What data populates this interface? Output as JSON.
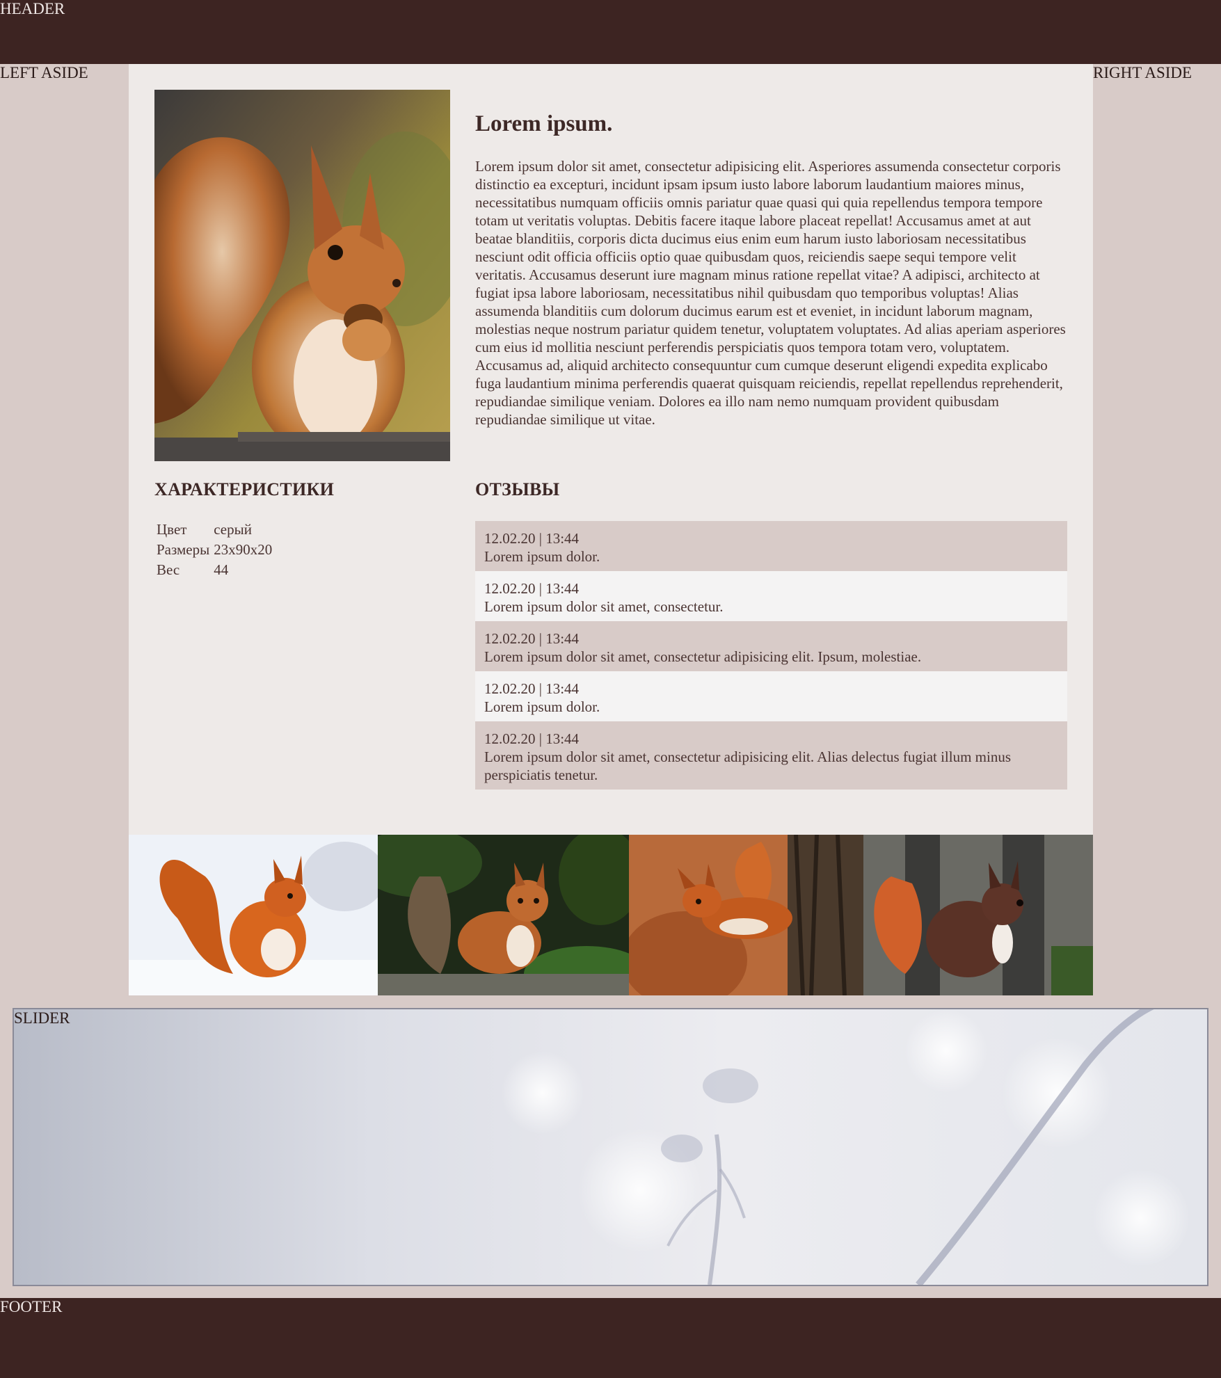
{
  "layout_labels": {
    "header": "HEADER",
    "left_aside": "LEFT ASIDE",
    "right_aside": "RIGHT ASIDE",
    "slider": "SLIDER",
    "footer": "FOOTER"
  },
  "product": {
    "title": "Lorem ipsum.",
    "description": "Lorem ipsum dolor sit amet, consectetur adipisicing elit. Asperiores assumenda consectetur corporis distinctio ea excepturi, incidunt ipsam ipsum iusto labore laborum laudantium maiores minus, necessitatibus numquam officiis omnis pariatur quae quasi qui quia repellendus tempora tempore totam ut veritatis voluptas. Debitis facere itaque labore placeat repellat! Accusamus amet at aut beatae blanditiis, corporis dicta ducimus eius enim eum harum iusto laboriosam necessitatibus nesciunt odit officia officiis optio quae quibusdam quos, reiciendis saepe sequi tempore velit veritatis. Accusamus deserunt iure magnam minus ratione repellat vitae? A adipisci, architecto at fugiat ipsa labore laboriosam, necessitatibus nihil quibusdam quo temporibus voluptas! Alias assumenda blanditiis cum dolorum ducimus earum est et eveniet, in incidunt laborum magnam, molestias neque nostrum pariatur quidem tenetur, voluptatem voluptates. Ad alias aperiam asperiores cum eius id mollitia nesciunt perferendis perspiciatis quos tempora totam vero, voluptatem. Accusamus ad, aliquid architecto consequuntur cum cumque deserunt eligendi expedita explicabo fuga laudantium minima perferendis quaerat quisquam reiciendis, repellat repellendus reprehenderit, repudiandae similique veniam. Dolores ea illo nam nemo numquam provident quibusdam repudiandae similique ut vitae."
  },
  "specs": {
    "heading": "ХАРАКТЕРИСТИКИ",
    "rows": [
      {
        "label": "Цвет",
        "value": "серый"
      },
      {
        "label": "Размеры",
        "value": "23х90х20"
      },
      {
        "label": "Вес",
        "value": "44"
      }
    ]
  },
  "reviews": {
    "heading": "ОТЗЫВЫ",
    "items": [
      {
        "date": "12.02.20 | 13:44",
        "text": "Lorem ipsum dolor."
      },
      {
        "date": "12.02.20 | 13:44",
        "text": "Lorem ipsum dolor sit amet, consectetur."
      },
      {
        "date": "12.02.20 | 13:44",
        "text": "Lorem ipsum dolor sit amet, consectetur adipisicing elit. Ipsum, molestiae."
      },
      {
        "date": "12.02.20 | 13:44",
        "text": "Lorem ipsum dolor."
      },
      {
        "date": "12.02.20 | 13:44",
        "text": "Lorem ipsum dolor sit amet, consectetur adipisicing elit. Alias delectus fugiat illum minus perspiciatis tenetur."
      }
    ]
  },
  "colors": {
    "header_footer_bg": "#3d2422",
    "page_bg": "#d8cbc8",
    "main_bg": "#eeeae8",
    "review_alt_bg": "#f4f3f3",
    "text": "#3d2826"
  }
}
